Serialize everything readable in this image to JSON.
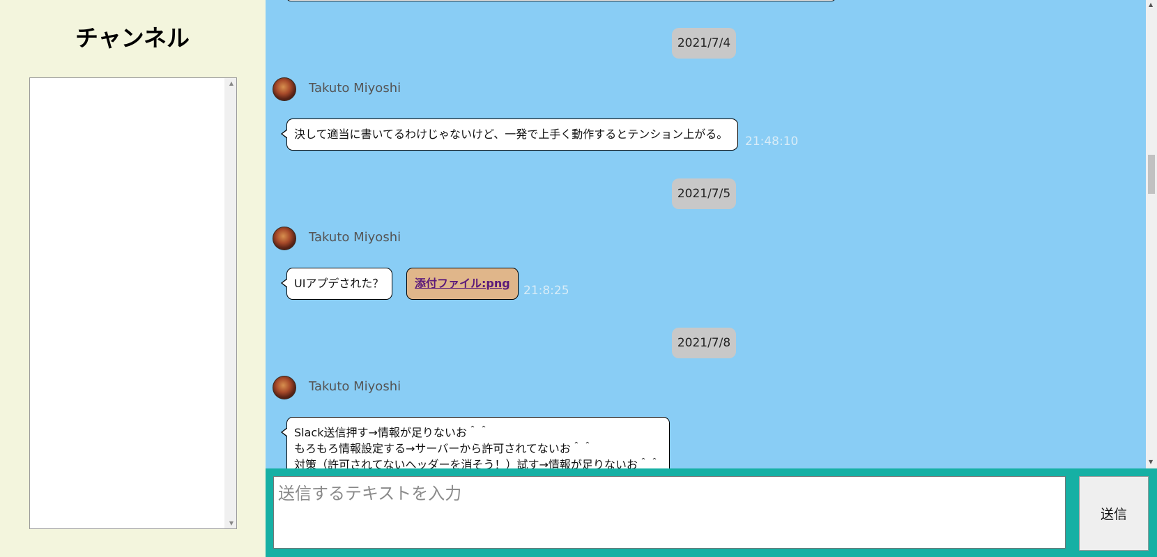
{
  "sidebar": {
    "title": "チャンネル"
  },
  "messages": [
    {
      "date": "2021/7/4",
      "user": "Takuto Miyoshi",
      "text": "決して適当に書いてるわけじゃないけど、一発で上手く動作するとテンション上がる。",
      "time": "21:48:10"
    },
    {
      "date": "2021/7/5",
      "user": "Takuto Miyoshi",
      "text": "UIアプデされた？",
      "attachment": "添付ファイル:png",
      "time": "21:8:25"
    },
    {
      "date": "2021/7/8",
      "user": "Takuto Miyoshi",
      "lines": [
        "Slack送信押す→情報が足りないお＾＾",
        "もろもろ情報設定する→サーバーから許可されてないお＾＾",
        "対策（許可されてないヘッダーを消そう！）試す→情報が足りないお＾＾"
      ]
    }
  ],
  "composer": {
    "placeholder": "送信するテキストを入力",
    "send_label": "送信"
  },
  "colors": {
    "sidebar_bg": "#f3f5dd",
    "chat_bg": "#89cdf5",
    "composer_bg": "#16b0a4",
    "attachment_bg": "#e0b68a"
  }
}
